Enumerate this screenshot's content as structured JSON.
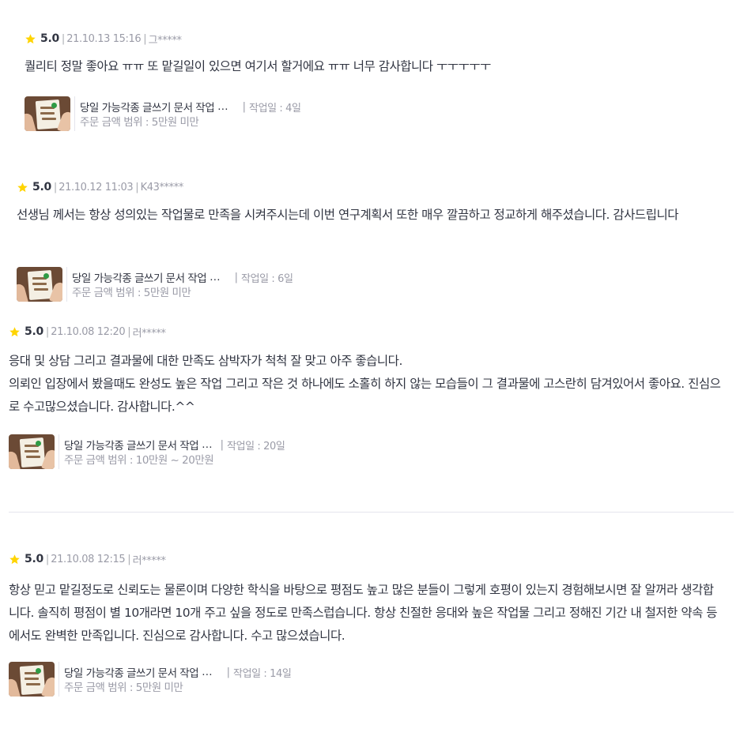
{
  "colors": {
    "star": "#ffd400",
    "text": "#303441",
    "muted": "#9a9ba7",
    "divider": "#e4e5ed"
  },
  "icons": {
    "rating": "star-icon",
    "thumbnail": "service-thumbnail-image"
  },
  "reviews": [
    {
      "score": "5.0",
      "date": "21.10.13 15:16",
      "user": "그*****",
      "text": "퀄리티 정말 좋아요 ㅠㅠ 또 맡길일이 있으면 여기서 할거에요 ㅠㅠ 너무 감사합니다 ㅜㅜㅜㅜㅜ",
      "service": {
        "title": "당일 가능각종 글쓰기 문서 작업",
        "ellipsis": "…",
        "work_days": "작업일 : 4일",
        "price_range": "주문 금액 범위 : 5만원 미만"
      }
    },
    {
      "score": "5.0",
      "date": "21.10.12 11:03",
      "user": "K43*****",
      "text": "선생님 께서는 항상 성의있는 작업물로 만족을 시켜주시는데 이번 연구계획서 또한 매우 깔끔하고 정교하게 해주셨습니다. 감사드립니다",
      "service": {
        "title": "당일 가능각종 글쓰기 문서 작업",
        "ellipsis": "…",
        "work_days": "작업일 : 6일",
        "price_range": "주문 금액 범위 : 5만원 미만"
      }
    },
    {
      "score": "5.0",
      "date": "21.10.08 12:20",
      "user": "러*****",
      "text": "응대 및 상담 그리고 결과물에 대한 만족도 삼박자가 척척 잘 맞고 아주 좋습니다.\n의뢰인 입장에서 봤을때도 완성도 높은 작업 그리고 작은 것 하나에도 소홀히 하지 않는 모습들이 그 결과물에 고스란히 담겨있어서 좋아요. 진심으로 수고많으셨습니다. 감사합니다.^^",
      "service": {
        "title": "당일 가능각종 글쓰기 문서 작업",
        "ellipsis": "…",
        "work_days": "작업일 : 20일",
        "price_range": "주문 금액 범위 : 10만원 ~ 20만원"
      }
    },
    {
      "score": "5.0",
      "date": "21.10.08 12:15",
      "user": "러*****",
      "text": "항상 믿고 맡길정도로 신뢰도는 물론이며 다양한 학식을 바탕으로 평점도 높고 많은 분들이 그렇게 호평이 있는지 경험해보시면 잘 알꺼라 생각합니다. 솔직히 평점이 별 10개라면 10개 주고 싶을 정도로 만족스럽습니다. 항상 친절한 응대와 높은 작업물 그리고 정해진 기간 내 철저한 약속 등에서도 완벽한 만족입니다. 진심으로 감사합니다. 수고 많으셨습니다.",
      "service": {
        "title": "당일 가능각종 글쓰기 문서 작업",
        "ellipsis": "…",
        "work_days": "작업일 : 14일",
        "price_range": "주문 금액 범위 : 5만원 미만"
      }
    }
  ]
}
